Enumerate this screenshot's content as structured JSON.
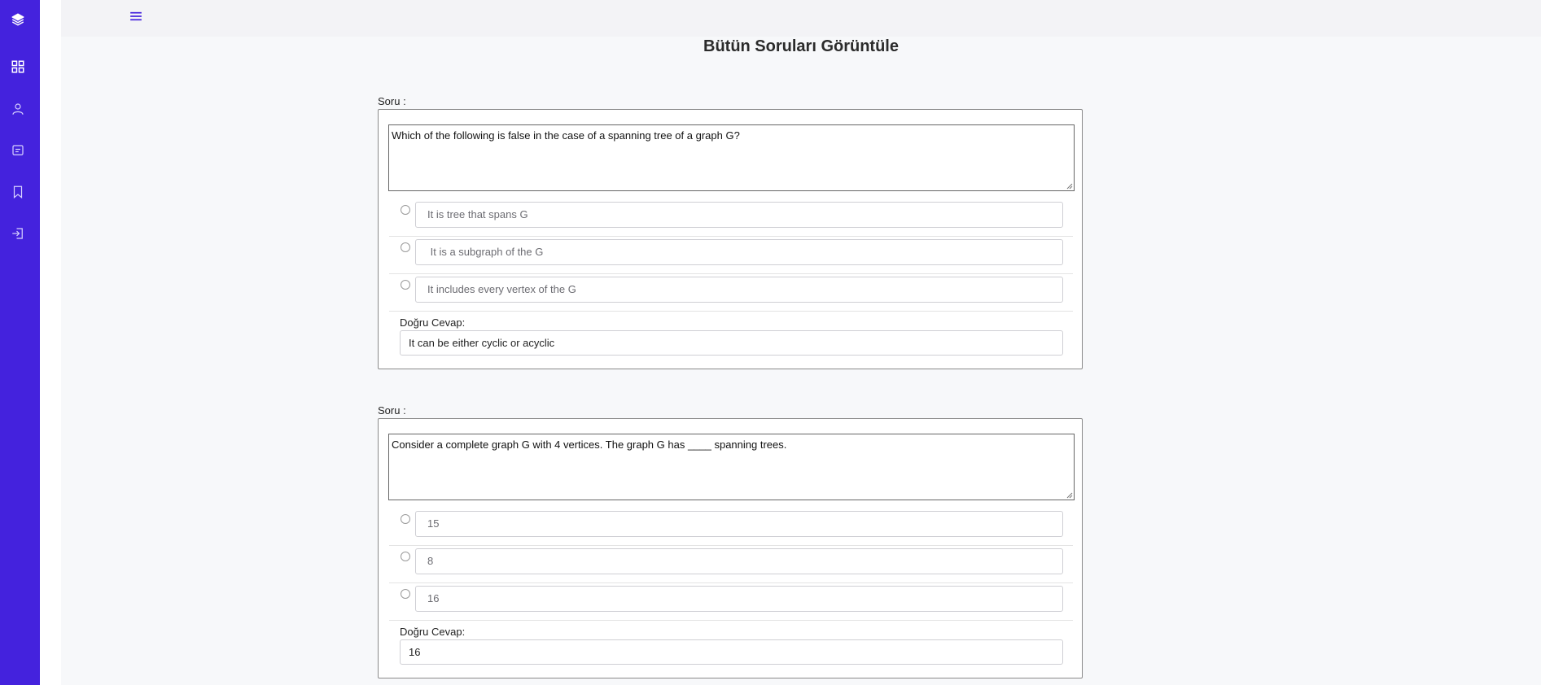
{
  "sidebar": {
    "icons": [
      "layers-icon",
      "grid-icon",
      "user-icon",
      "message-icon",
      "bookmark-icon",
      "logout-icon"
    ]
  },
  "header": {
    "menu_icon": "hamburger-menu-icon",
    "title": "Bütün Soruları Görüntüle"
  },
  "questions": [
    {
      "label": "Soru :",
      "text": "Which of the following is false in the case of a spanning tree of a graph G?",
      "options": [
        "It is tree that spans G",
        " It is a subgraph of the G",
        "It includes every vertex of the G"
      ],
      "correct_label": "Doğru Cevap:",
      "correct_answer": "It can be either cyclic or acyclic"
    },
    {
      "label": "Soru :",
      "text": "Consider a complete graph G with 4 vertices. The graph G has ____ spanning trees.",
      "options": [
        "15",
        "8",
        "16"
      ],
      "correct_label": "Doğru Cevap:",
      "correct_answer": "16"
    }
  ],
  "colors": {
    "sidebar_bg": "#4422dd",
    "page_bg": "#f7f8fa",
    "accent": "#4422dd"
  }
}
